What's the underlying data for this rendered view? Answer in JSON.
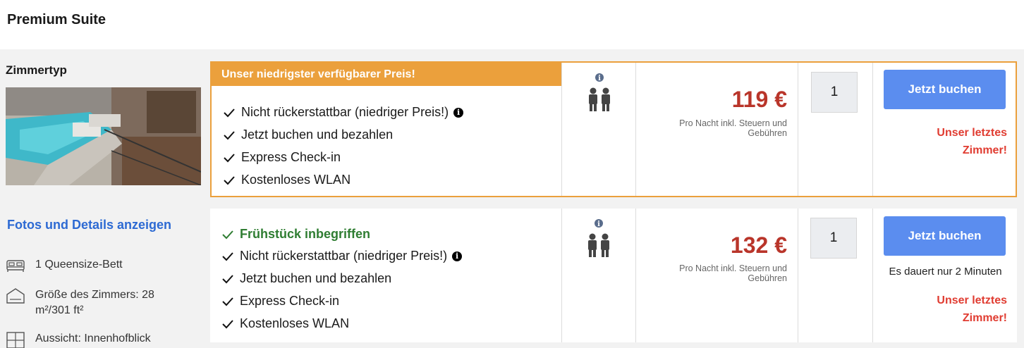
{
  "page": {
    "title": "Premium Suite"
  },
  "sidebar": {
    "heading": "Zimmertyp",
    "details_link": "Fotos und Details anzeigen",
    "features": [
      {
        "icon": "bed-icon",
        "text": "1 Queensize-Bett"
      },
      {
        "icon": "room-size-icon",
        "text": "Größe des Zimmers: 28 m²/301 ft²"
      },
      {
        "icon": "window-view-icon",
        "text": "Aussicht: Innenhofblick"
      }
    ]
  },
  "rates": [
    {
      "badge": "Unser niedrigster verfügbarer Preis!",
      "highlight": "",
      "conditions": [
        "Nicht rückerstattbar (niedriger Preis!)",
        "Jetzt buchen und bezahlen",
        "Express Check-in",
        "Kostenloses WLAN"
      ],
      "price": "119 €",
      "price_note": "Pro Nacht inkl. Steuern und Gebühren",
      "quantity": "1",
      "book_label": "Jetzt buchen",
      "availability_note": "",
      "last_room": "Unser letztes Zimmer!"
    },
    {
      "badge": "",
      "highlight": "Frühstück inbegriffen",
      "conditions": [
        "Nicht rückerstattbar (niedriger Preis!)",
        "Jetzt buchen und bezahlen",
        "Express Check-in",
        "Kostenloses WLAN"
      ],
      "price": "132 €",
      "price_note": "Pro Nacht inkl. Steuern und Gebühren",
      "quantity": "1",
      "book_label": "Jetzt buchen",
      "availability_note": "Es dauert nur 2 Minuten",
      "last_room": "Unser letztes Zimmer!"
    }
  ],
  "colors": {
    "accent": "#eba03c",
    "button": "#5b8def",
    "price": "#b9352a",
    "urgent": "#e03c31",
    "included": "#2f7d32",
    "link": "#2d6ad3"
  }
}
